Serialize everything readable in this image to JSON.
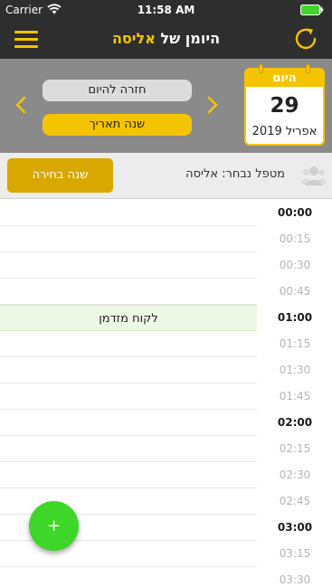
{
  "status_bar": {
    "carrier": "Carrier",
    "time": "11:58 AM"
  },
  "header": {
    "title_prefix": "היומן של ",
    "title_name": "אליסה",
    "accent_color": "#f5c400"
  },
  "date_panel": {
    "back_to_today_label": "חזרה להיום",
    "change_date_label": "שנה תאריך",
    "calendar": {
      "header": "היום",
      "day": "29",
      "month_year": "אפריל 2019"
    }
  },
  "therapist": {
    "change_selection_label": "שנה בחירה",
    "selected_label": "מטפל נבחר: אליסה"
  },
  "schedule": {
    "times": [
      "00:00",
      "00:15",
      "00:30",
      "00:45",
      "01:00",
      "01:15",
      "01:30",
      "01:45",
      "02:00",
      "02:15",
      "02:30",
      "02:45",
      "03:00",
      "03:15",
      "03:30"
    ],
    "hour_marks": [
      "00:00",
      "01:00",
      "02:00",
      "03:00"
    ],
    "events": [
      {
        "title": "לקוח מזדמן",
        "slot_index": 4,
        "color": "#eef8e6"
      }
    ]
  },
  "fab": {
    "label": "+",
    "color": "#3fd62a"
  }
}
